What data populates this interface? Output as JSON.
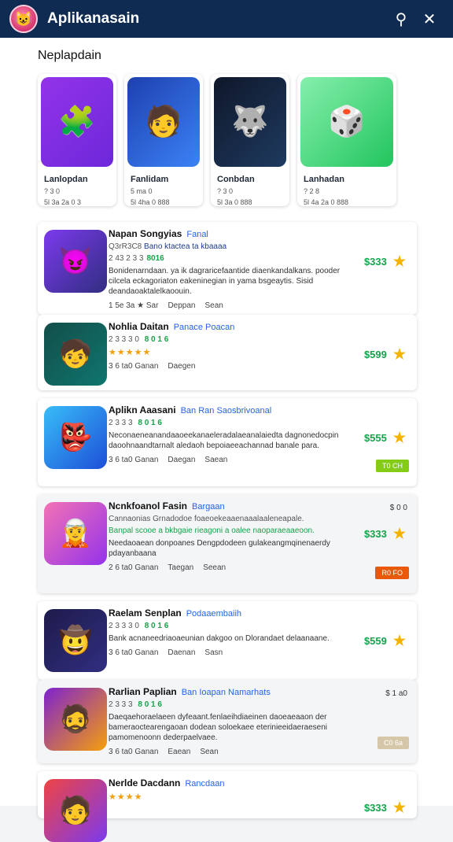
{
  "header": {
    "title": "Aplikanasain",
    "search_icon": "search-icon",
    "close_icon": "close-icon"
  },
  "featured": {
    "title": "Neplapdain",
    "cards": [
      {
        "title": "Lanlopdan",
        "sub": "? 3 0",
        "sub2": "5l 3a 2a 0 3",
        "icon": "🧩",
        "bg": "#7c3aed"
      },
      {
        "title": "Fanlidam",
        "sub": "5 ma 0",
        "sub2": "5l 4ha 0 888",
        "icon": "🧑",
        "bg": "#1d4ed8"
      },
      {
        "title": "Conbdan",
        "sub": "? 3 0",
        "sub2": "5l 3a 0 888",
        "icon": "🐺",
        "bg": "#1e3a5f"
      },
      {
        "title": "Lanhadan",
        "sub": "? 2 8",
        "sub2": "5l 4a 2a 0 888",
        "icon": "🎲",
        "bg": "#4ade80"
      }
    ]
  },
  "list": [
    {
      "title": "Napan Songyias",
      "tag": "Fanal",
      "meta": "Q3rR3C8",
      "meta_tag": "Bano ktactea ta kbaaaa",
      "rating": "2 43 2 3 3",
      "rating_green": "8016",
      "desc": "Bonidenarndaan. ya ik dagraricefaantide diaenkandalkans. pooder cilcela eckagoriaton eakeninegian in yama bsgeaytis. Sisid deandaoaktalelkaoouin.",
      "foot": [
        "1 5e 3a  ★ Sar",
        "Deppan",
        "Sean"
      ],
      "price": "$333",
      "icon": "😈",
      "bg": "#5b21b6"
    },
    {
      "title": "Nohlia Daitan",
      "tag": "Panace Poacan",
      "meta": "2 3 3 3 0",
      "meta_tag": "8 0 1 6",
      "rating": "★★★★★",
      "rating_green": "",
      "desc": "",
      "foot": [
        "3 6 ta0 Ganan",
        "Daegen"
      ],
      "price": "$599",
      "icon": "🧒",
      "bg": "#0f766e"
    },
    {
      "title": "Aplikn Aaasani",
      "tag": "Ban  Ran Saosbrivoanal",
      "meta": "2 3 3 3",
      "meta_tag": "8 0 1 6",
      "rating": "",
      "rating_green": "",
      "desc": "Neconaeneanandaaoeekanaeleradalaeanalaiedta dagnonedocpin daoohnaandtarnalt aledaoh bepoiaeeachannad banale para.",
      "foot": [
        "3 6 ta0 Ganan",
        "Daegan",
        "Saean"
      ],
      "price": "$555",
      "badge": "T0 CH",
      "badge_bg": "#84cc16",
      "icon": "👺",
      "bg": "#0ea5e9"
    },
    {
      "title": "Ncnkfoanol Fasin",
      "tag": "Bargaan",
      "meta": "Cannaonias  Grnadodoe foaeoekeaaenaaalaaleneapale.",
      "meta_tag": "",
      "rating": "",
      "rating_green": "Banpal scooe a bkbgaie rieagoni a oalee naoparaeaaeoon.",
      "desc": "Needaoaean donpoanes Dengpdodeen gulakeangmqinenaerdy pdayanbaana",
      "foot": [
        "2 6 ta0 Ganan",
        "Taegan",
        "Seean"
      ],
      "price": "$333",
      "badge": "R0 FO",
      "badge_bg": "#ea580c",
      "corner": "$ 0 0",
      "icon": "🧝",
      "bg": "#db2777"
    },
    {
      "title": "Raelam Senplan",
      "tag": "Podaaembaiih",
      "meta": "2 3 3 3 0",
      "meta_tag": "8 0 1 6",
      "rating": "",
      "rating_green": "",
      "desc": "Bank acnaneedriaoaeunian dakgoo on Dlorandaet delaanaane.",
      "foot": [
        "3 6 ta0 Ganan",
        "Daenan",
        "Sasn"
      ],
      "price": "$559",
      "icon": "🤠",
      "bg": "#1e1b4b"
    },
    {
      "title": "Rarlian Paplian",
      "tag": "Ban  Ioapan  Namarhats",
      "meta": "2 3 3 3",
      "meta_tag": "8 0 1 6",
      "rating": "",
      "rating_green": "",
      "desc": "Daeqaehoraelaeen dyfeaant.fenlaeihdiaeinen daoeaeaaon der bameraoctearengaoan dodean soloekaee eterinieeidaeraeseni pamomenoonn dederpaelvaee.",
      "foot": [
        "3 6 ta0 Ganan",
        "Eaean",
        "Sean"
      ],
      "price": "",
      "badge": "C0 6a",
      "badge_bg": "#d6c7a8",
      "corner": "$ 1 a0",
      "icon": "🧔",
      "bg": "#7e22ce"
    },
    {
      "title": "Nerlde Dacdann",
      "tag": "Rancdaan",
      "meta": "",
      "meta_tag": "",
      "rating": "★★★★",
      "rating_green": "",
      "desc": "",
      "foot": [],
      "price": "$333",
      "icon": "🧑",
      "bg": "#dc2626"
    }
  ]
}
